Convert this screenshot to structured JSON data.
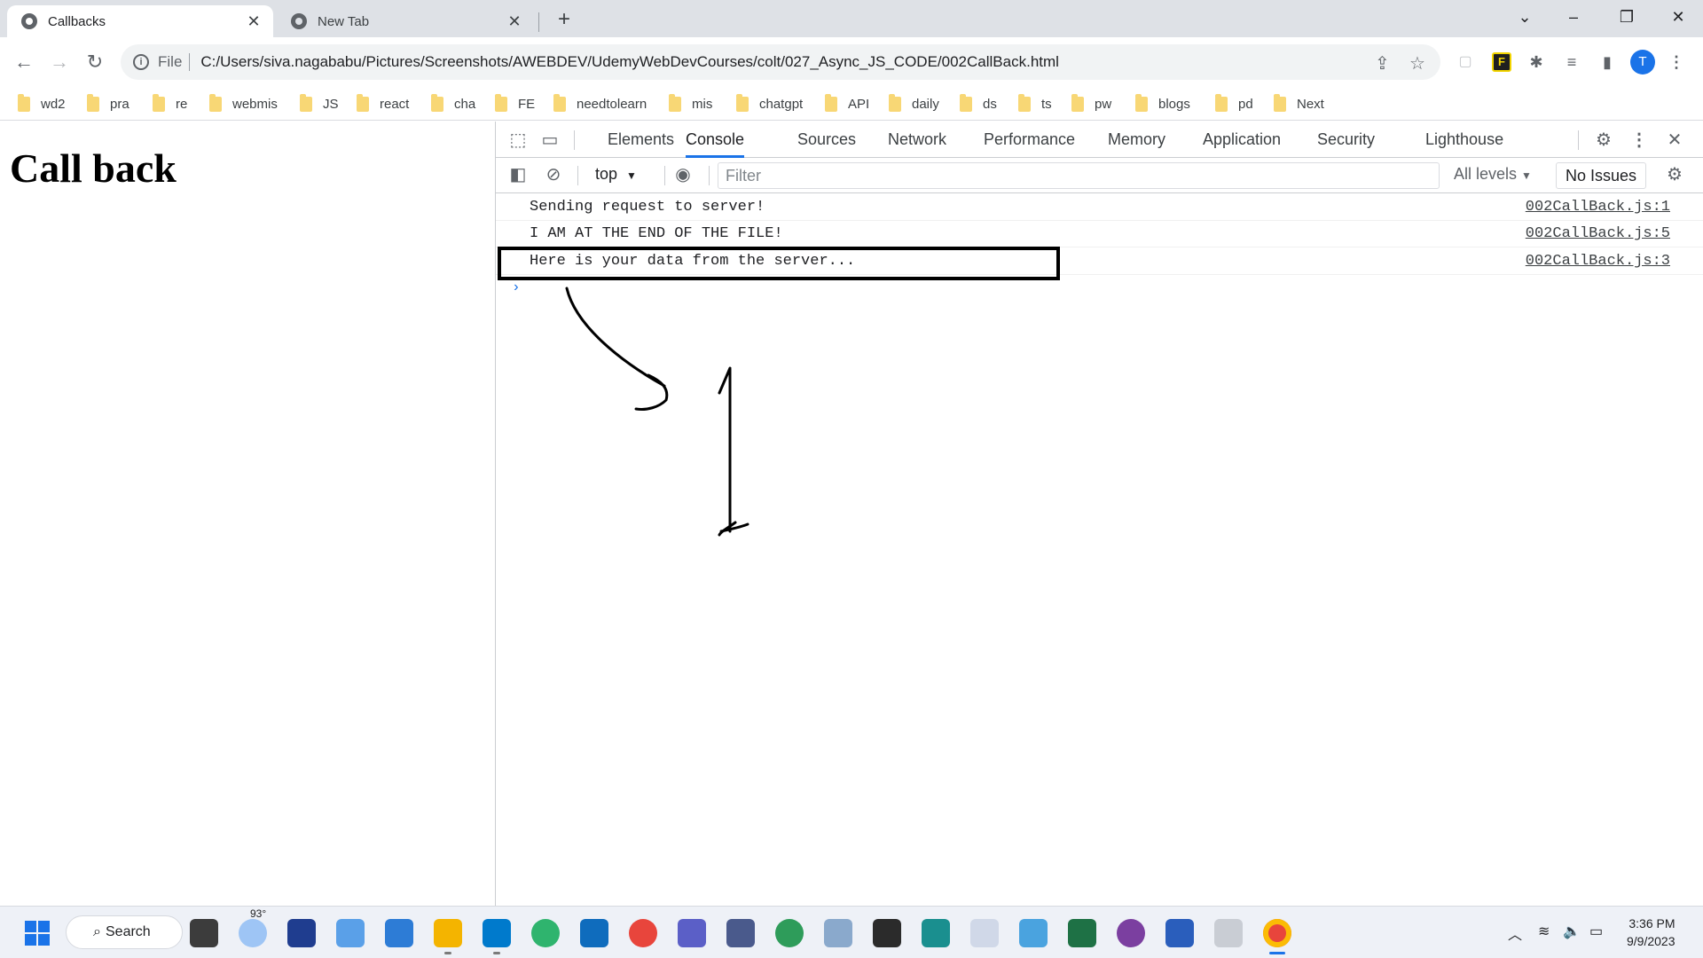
{
  "browser": {
    "tabs": [
      {
        "title": "Callbacks",
        "active": true
      },
      {
        "title": "New Tab",
        "active": false
      }
    ],
    "address": {
      "scheme": "File",
      "url": "C:/Users/siva.nagababu/Pictures/Screenshots/AWEBDEV/UdemyWebDevCourses/colt/027_Async_JS_CODE/002CallBack.html"
    },
    "profile_initial": "T",
    "bookmarks": [
      "wd2",
      "pra",
      "re",
      "webmis",
      "JS",
      "react",
      "cha",
      "FE",
      "needtolearn",
      "mis",
      "chatgpt",
      "API",
      "daily",
      "ds",
      "ts",
      "pw",
      "blogs",
      "pd",
      "Next"
    ]
  },
  "page": {
    "heading": "Call back"
  },
  "devtools": {
    "tabs": [
      "Elements",
      "Console",
      "Sources",
      "Network",
      "Performance",
      "Memory",
      "Application",
      "Security",
      "Lighthouse"
    ],
    "active_tab": "Console",
    "context": "top",
    "filter_placeholder": "Filter",
    "levels": "All levels",
    "issues": "No Issues",
    "messages": [
      {
        "text": "Sending request to server!",
        "source": "002CallBack.js:1"
      },
      {
        "text": "I AM AT THE END OF THE FILE!",
        "source": "002CallBack.js:5"
      },
      {
        "text": "Here is your data from the server...",
        "source": "002CallBack.js:3",
        "highlighted": true
      }
    ]
  },
  "taskbar": {
    "search_label": "Search",
    "weather_temp": "93°",
    "time": "3:36 PM",
    "date": "9/9/2023"
  },
  "colors": {
    "accent": "#1a73e8",
    "tabstrip_bg": "#dee1e6",
    "omnibox_bg": "#f1f3f4",
    "folder": "#f8d775"
  }
}
